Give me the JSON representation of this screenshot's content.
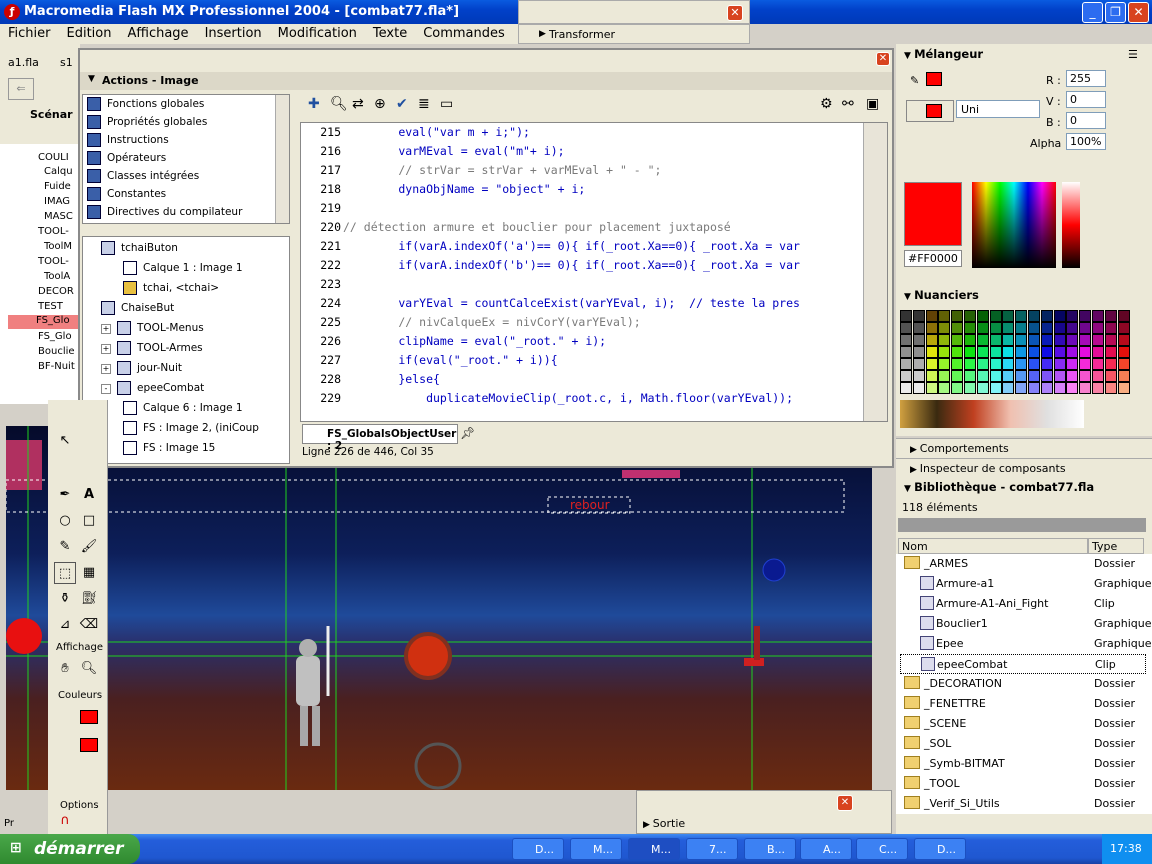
{
  "app": {
    "title": "Macromedia Flash MX Professionnel 2004 - [combat77.fla*]",
    "icon": "flash-icon"
  },
  "menu": [
    "Fichier",
    "Edition",
    "Affichage",
    "Insertion",
    "Modification",
    "Texte",
    "Commandes"
  ],
  "transformer_panel": {
    "title": "Transformer"
  },
  "doc_tabs": [
    "a1.fla",
    "s1"
  ],
  "scene_label": "Scénar",
  "layers": [
    "COULI",
    "Calqu",
    "Fuide",
    "IMAG",
    "MASC",
    "TOOL-",
    "ToolM",
    "TOOL-",
    "ToolA",
    "DECOR",
    "TEST",
    "FS_Glo",
    "FS_Glo",
    "Bouclie",
    "BF-Nuit"
  ],
  "actions": {
    "title": "Actions - Image",
    "categories": [
      "Fonctions globales",
      "Propriétés globales",
      "Instructions",
      "Opérateurs",
      "Classes intégrées",
      "Constantes",
      "Directives du compilateur"
    ],
    "tree": [
      {
        "label": "tchaiButon",
        "indent": 1,
        "type": "symbol",
        "exp": ""
      },
      {
        "label": "Calque 1 : Image 1",
        "indent": 2,
        "type": "frame",
        "exp": ""
      },
      {
        "label": "tchai, <tchai>",
        "indent": 2,
        "type": "instance",
        "exp": ""
      },
      {
        "label": "ChaiseBut",
        "indent": 1,
        "type": "symbol",
        "exp": ""
      },
      {
        "label": "TOOL-Menus",
        "indent": 1,
        "type": "symbol",
        "exp": "+"
      },
      {
        "label": "TOOL-Armes",
        "indent": 1,
        "type": "symbol",
        "exp": "+"
      },
      {
        "label": "jour-Nuit",
        "indent": 1,
        "type": "symbol",
        "exp": "+"
      },
      {
        "label": "epeeCombat",
        "indent": 1,
        "type": "symbol",
        "exp": "-"
      },
      {
        "label": "Calque 6 : Image 1",
        "indent": 2,
        "type": "frame",
        "exp": ""
      },
      {
        "label": "FS : Image 2, (iniCoup",
        "indent": 2,
        "type": "frame",
        "exp": ""
      },
      {
        "label": "FS : Image 15",
        "indent": 2,
        "type": "frame",
        "exp": ""
      }
    ],
    "code": [
      {
        "n": "215",
        "t": "        eval(\"var m + i;\");",
        "c": "kw"
      },
      {
        "n": "216",
        "t": "        varMEval = eval(\"m\"+ i);",
        "c": "kw"
      },
      {
        "n": "217",
        "t": "        // strVar = strVar + varMEval + \" - \";",
        "c": "cm"
      },
      {
        "n": "218",
        "t": "        dynaObjName = \"object\" + i;",
        "c": "kw"
      },
      {
        "n": "219",
        "t": "",
        "c": ""
      },
      {
        "n": "220",
        "t": "// détection armure et bouclier pour placement juxtaposé",
        "c": "cm"
      },
      {
        "n": "221",
        "t": "        if(varA.indexOf('a')== 0){ if(_root.Xa==0){ _root.Xa = var",
        "c": "kw"
      },
      {
        "n": "222",
        "t": "        if(varA.indexOf('b')== 0){ if(_root.Xa==0){ _root.Xa = var",
        "c": "kw"
      },
      {
        "n": "223",
        "t": "",
        "c": ""
      },
      {
        "n": "224",
        "t": "        varYEval = countCalceExist(varYEval, i);  // teste la pres",
        "c": "kw"
      },
      {
        "n": "225",
        "t": "        // nivCalqueEx = nivCorY(varYEval);",
        "c": "cm"
      },
      {
        "n": "226",
        "t": "        clipName = eval(\"_root.\" + i);",
        "c": "kw"
      },
      {
        "n": "227",
        "t": "        if(eval(\"_root.\" + i)){",
        "c": "kw"
      },
      {
        "n": "228",
        "t": "        }else{",
        "c": "kw"
      },
      {
        "n": "229",
        "t": "            duplicateMovieClip(_root.c, i, Math.floor(varYEval));",
        "c": "kw"
      }
    ],
    "tab": "FS_GlobalsObjectUser : 2",
    "status": "Ligne 226 de 446, Col 35"
  },
  "stage": {
    "text_label": "rebour"
  },
  "tools": {
    "affichage": "Affichage",
    "couleurs": "Couleurs",
    "options": "Options"
  },
  "mixer": {
    "title": "Mélangeur",
    "fill_type": "Uni",
    "r_label": "R :",
    "r": "255",
    "v_label": "V :",
    "v": "0",
    "b_label": "B :",
    "b": "0",
    "alpha_label": "Alpha :",
    "alpha": "100%",
    "hex": "#FF0000",
    "color": "#ff0000"
  },
  "swatches": {
    "title": "Nuanciers"
  },
  "panels": {
    "comportements": "Comportements",
    "inspecteur": "Inspecteur de composants"
  },
  "library": {
    "title": "Bibliothèque - combat77.fla",
    "count": "118 éléments",
    "col_name": "Nom",
    "col_type": "Type",
    "items": [
      {
        "name": "_ARMES",
        "type": "Dossier",
        "kind": "folder-open"
      },
      {
        "name": "Armure-a1",
        "type": "Graphique",
        "kind": "graphic"
      },
      {
        "name": "Armure-A1-Ani_Fight",
        "type": "Clip",
        "kind": "clip"
      },
      {
        "name": "Bouclier1",
        "type": "Graphique",
        "kind": "graphic"
      },
      {
        "name": "Epee",
        "type": "Graphique",
        "kind": "graphic"
      },
      {
        "name": "epeeCombat",
        "type": "Clip",
        "kind": "clip"
      },
      {
        "name": "_DECORATION",
        "type": "Dossier",
        "kind": "folder"
      },
      {
        "name": "_FENETTRE",
        "type": "Dossier",
        "kind": "folder"
      },
      {
        "name": "_SCENE",
        "type": "Dossier",
        "kind": "folder"
      },
      {
        "name": "_SOL",
        "type": "Dossier",
        "kind": "folder"
      },
      {
        "name": "_Symb-BITMAT",
        "type": "Dossier",
        "kind": "folder"
      },
      {
        "name": "_TOOL",
        "type": "Dossier",
        "kind": "folder"
      },
      {
        "name": "_Verif_Si_Utils",
        "type": "Dossier",
        "kind": "folder"
      }
    ]
  },
  "sortie": {
    "title": "Sortie"
  },
  "bottom_left": "Pr",
  "taskbar": {
    "start": "démarrer",
    "tasks": [
      "D...",
      "M...",
      "M...",
      "7...",
      "B...",
      "A...",
      "C...",
      "D..."
    ],
    "clock": "17:38"
  }
}
